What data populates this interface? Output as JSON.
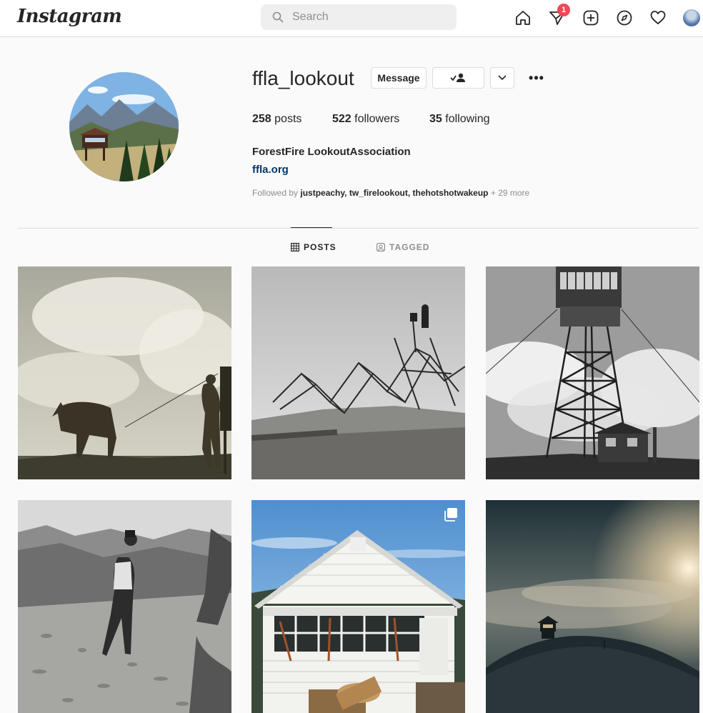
{
  "nav": {
    "logo": "Instagram",
    "search_placeholder": "Search",
    "dm_badge": "1",
    "icons": [
      "home-icon",
      "direct-icon",
      "new-post-icon",
      "explore-icon",
      "activity-icon",
      "profile-avatar"
    ]
  },
  "profile": {
    "username": "ffla_lookout",
    "message_label": "Message",
    "stats": {
      "posts_count": "258",
      "posts_label": "posts",
      "followers_count": "522",
      "followers_label": "followers",
      "following_count": "35",
      "following_label": "following"
    },
    "full_name": "ForestFire LookoutAssociation",
    "website": "ffla.org",
    "followed_by_prefix": "Followed by",
    "followed_by_users": "justpeachy, tw_firelookout, thehotshotwakeup",
    "followed_by_more": "+ 29 more"
  },
  "tabs": {
    "posts": "POSTS",
    "tagged": "TAGGED"
  },
  "colors": {
    "accent_link": "#00376b",
    "badge": "#ed4956",
    "border": "#dbdbdb"
  },
  "posts": [
    {
      "subject": "horse-and-ranger"
    },
    {
      "subject": "tower-construction"
    },
    {
      "subject": "lookout-tower"
    },
    {
      "subject": "man-with-binoculars"
    },
    {
      "subject": "white-cabin",
      "multiple": true
    },
    {
      "subject": "foggy-lookout"
    }
  ]
}
